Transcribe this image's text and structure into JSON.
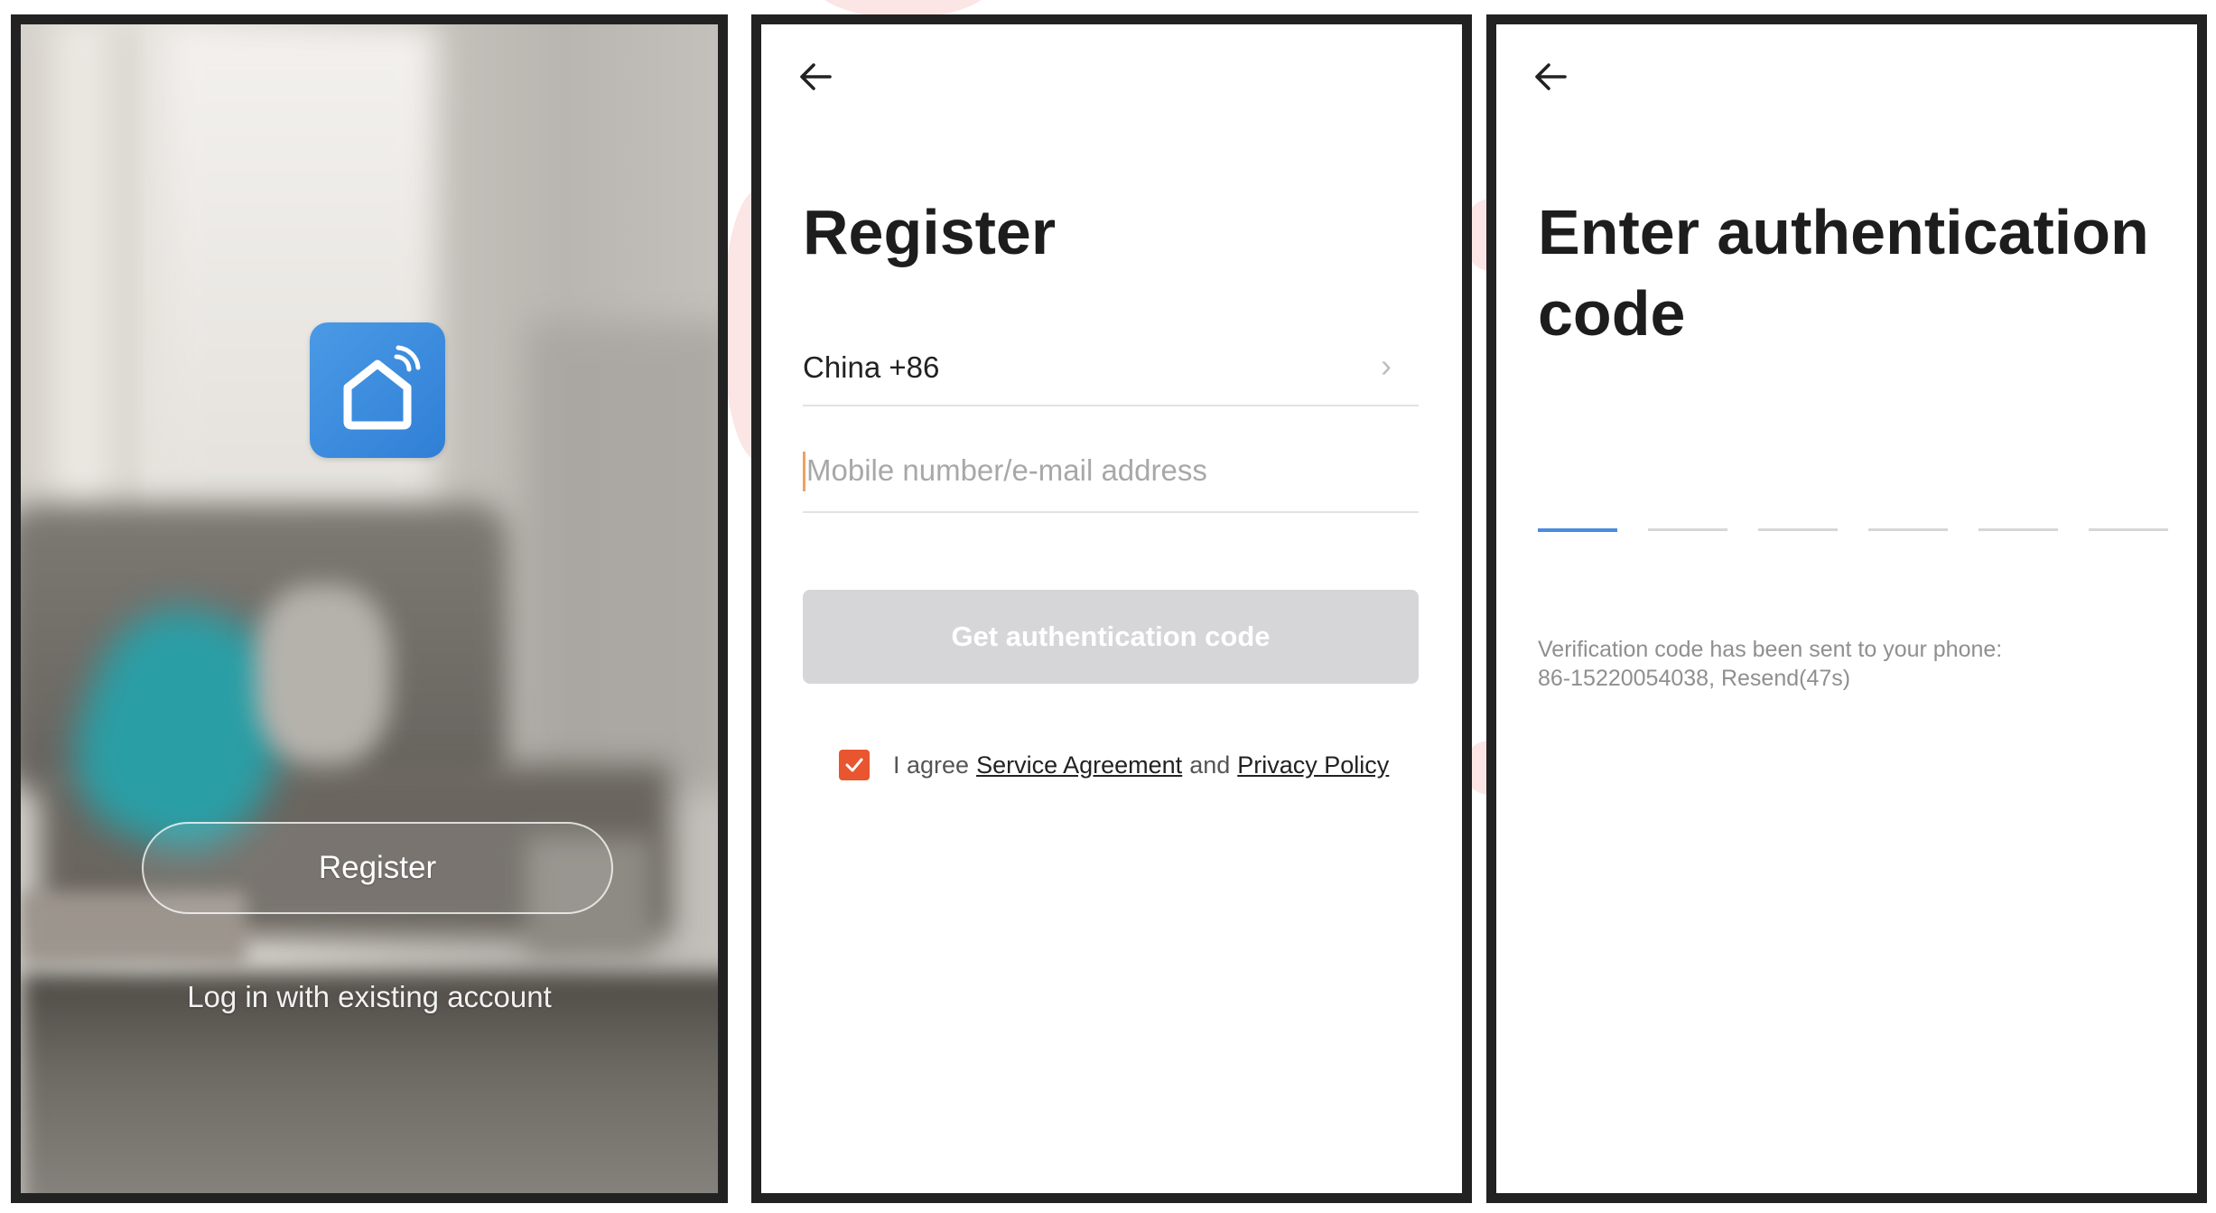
{
  "welcome": {
    "register_label": "Register",
    "login_label": "Log in with existing account",
    "app_icon": "smart-home-icon"
  },
  "register": {
    "title": "Register",
    "country": "China +86",
    "phone_placeholder": "Mobile number/e-mail address",
    "button_label": "Get authentication code",
    "agree_prefix": "I agree",
    "service_agreement": "Service Agreement",
    "and": "and",
    "privacy_policy": "Privacy Policy",
    "checkbox_checked": true
  },
  "auth": {
    "title_line1": "Enter authentication",
    "title_line2": "code",
    "code_digits": [
      "",
      "",
      "",
      "",
      "",
      ""
    ],
    "sent_line1": "Verification code has been sent to your phone:",
    "sent_line2": "86-15220054038, Resend(47s)"
  },
  "colors": {
    "accent": "#e8552e",
    "app_icon": "#3a8ae0",
    "active_slot": "#4a8be0",
    "disabled_button": "#d6d6d9"
  }
}
